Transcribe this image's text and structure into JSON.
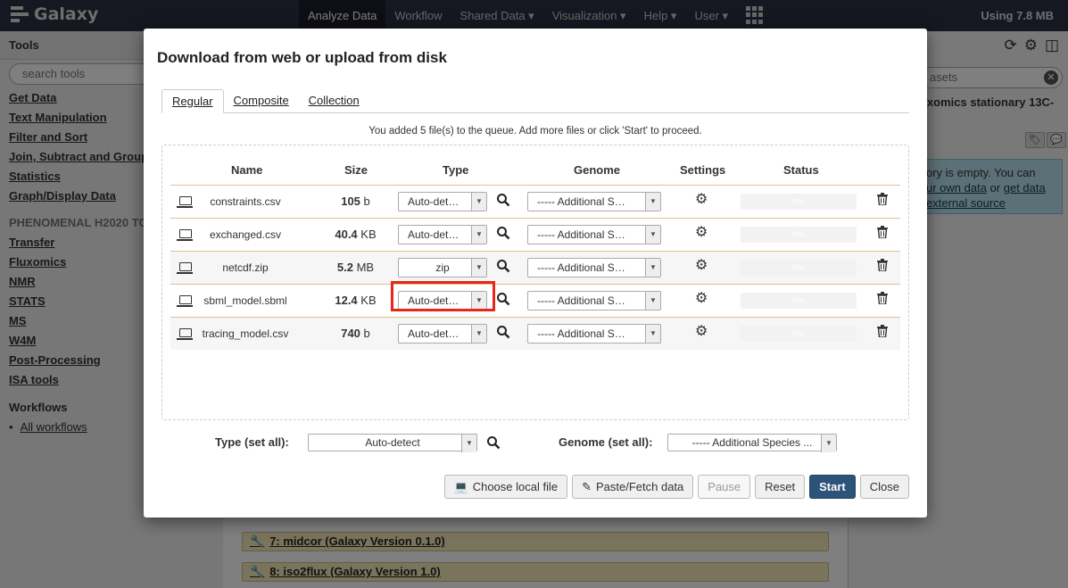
{
  "masthead": {
    "brand": "Galaxy",
    "nav": [
      "Analyze Data",
      "Workflow",
      "Shared Data ▾",
      "Visualization ▾",
      "Help ▾",
      "User ▾"
    ],
    "usage": "Using 7.8 MB"
  },
  "tools": {
    "title": "Tools",
    "search_placeholder": "search tools",
    "links_top": [
      "Get Data",
      "Text Manipulation",
      "Filter and Sort",
      "Join, Subtract and Group",
      "Statistics",
      "Graph/Display Data"
    ],
    "section_label": "PHENOMENAL H2020 TO",
    "links_bottom": [
      "Transfer",
      "Fluxomics",
      "NMR",
      "STATS",
      "MS",
      "W4M",
      "Post-Processing",
      "ISA tools"
    ],
    "workflows_title": "Workflows",
    "all_workflows": "All workflows"
  },
  "history": {
    "search_partial": "asets",
    "name_partial": "uxomics stationary 13C-",
    "empty_line1": "ory is empty. You can",
    "empty_link1": "ur own data",
    "empty_or": " or ",
    "empty_link2": "get data",
    "empty_link3": "external source",
    "jobs": [
      "7: midcor (Galaxy Version 0.1.0)",
      "8: iso2flux (Galaxy Version 1.0)"
    ]
  },
  "modal": {
    "title": "Download from web or upload from disk",
    "tabs": [
      "Regular",
      "Composite",
      "Collection"
    ],
    "queue_message": "You added 5 file(s) to the queue. Add more files or click 'Start' to proceed.",
    "headers": {
      "name": "Name",
      "size": "Size",
      "type": "Type",
      "genome": "Genome",
      "settings": "Settings",
      "status": "Status"
    },
    "rows": [
      {
        "name": "constraints.csv",
        "size_num": "105",
        "size_unit": "b",
        "type": "Auto-det…",
        "genome": "----- Additional S…",
        "progress": "0%"
      },
      {
        "name": "exchanged.csv",
        "size_num": "40.4",
        "size_unit": "KB",
        "type": "Auto-det…",
        "genome": "----- Additional S…",
        "progress": "0%"
      },
      {
        "name": "netcdf.zip",
        "size_num": "5.2",
        "size_unit": "MB",
        "type": "zip",
        "genome": "----- Additional S…",
        "progress": "0%"
      },
      {
        "name": "sbml_model.sbml",
        "size_num": "12.4",
        "size_unit": "KB",
        "type": "Auto-det…",
        "genome": "----- Additional S…",
        "progress": "0%"
      },
      {
        "name": "tracing_model.csv",
        "size_num": "740",
        "size_unit": "b",
        "type": "Auto-det…",
        "genome": "----- Additional S…",
        "progress": "0%"
      }
    ],
    "set_all": {
      "type_label": "Type (set all):",
      "type_value": "Auto-detect",
      "genome_label": "Genome (set all):",
      "genome_value": "----- Additional Species ..."
    },
    "buttons": {
      "choose_local": "Choose local file",
      "paste_fetch": "Paste/Fetch data",
      "pause": "Pause",
      "reset": "Reset",
      "start": "Start",
      "close": "Close"
    }
  }
}
